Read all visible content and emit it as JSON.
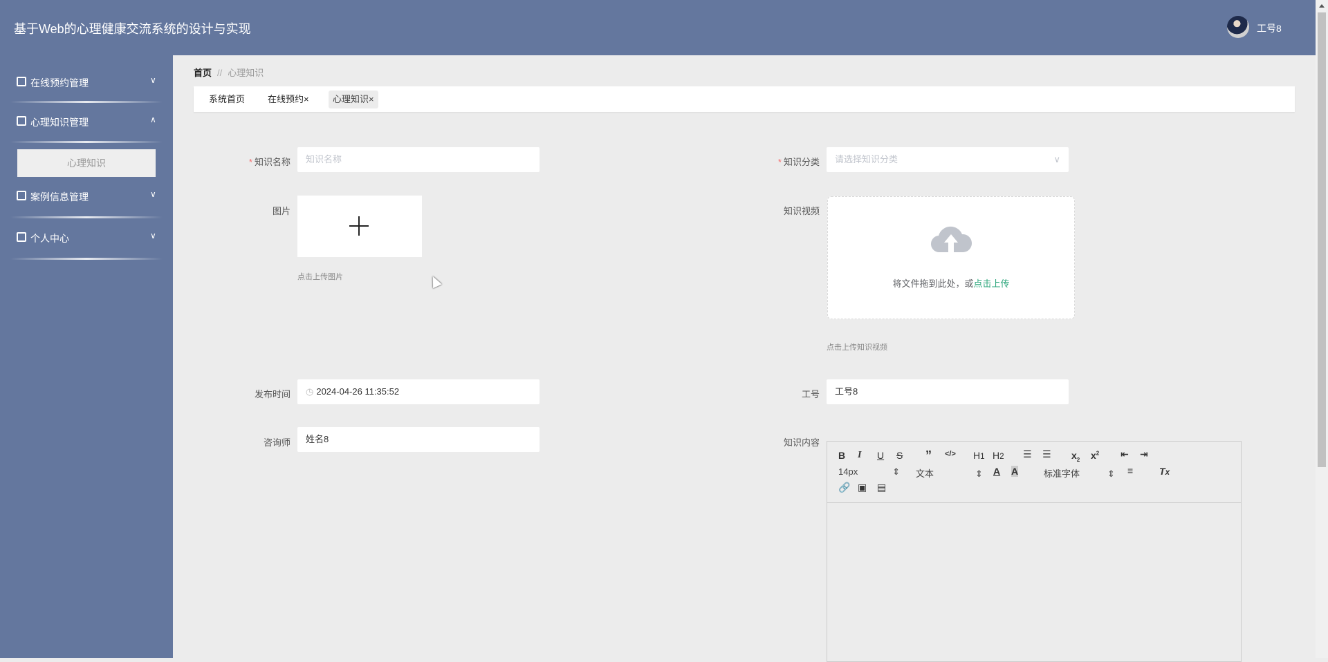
{
  "header": {
    "title": "基于Web的心理健康交流系统的设计与实现",
    "username": "工号8"
  },
  "sidebar": {
    "items": [
      {
        "label": "在线预约管理",
        "icon": "briefcase-icon",
        "expanded": false
      },
      {
        "label": "心理知识管理",
        "icon": "clipboard-icon",
        "expanded": true,
        "children": [
          "心理知识"
        ]
      },
      {
        "label": "案例信息管理",
        "icon": "grid-icon",
        "expanded": false
      },
      {
        "label": "个人中心",
        "icon": "wallet-icon",
        "expanded": false
      }
    ]
  },
  "breadcrumb": {
    "home": "首页",
    "separator": "//",
    "current": "心理知识"
  },
  "tabs": [
    {
      "label": "系统首页"
    },
    {
      "label": "在线预约",
      "close": "×"
    },
    {
      "label": "心理知识",
      "close": "×",
      "active": true
    }
  ],
  "form": {
    "name": {
      "label": "知识名称",
      "placeholder": "知识名称",
      "value": ""
    },
    "category": {
      "label": "知识分类",
      "placeholder": "请选择知识分类"
    },
    "picture": {
      "label": "图片",
      "hint": "点击上传图片"
    },
    "video": {
      "label": "知识视频",
      "drop_text": "将文件拖到此处，或",
      "click_text": "点击上传",
      "hint": "点击上传知识视频"
    },
    "publish_time": {
      "label": "发布时间",
      "value": "2024-04-26 11:35:52"
    },
    "staff_no": {
      "label": "工号",
      "value": "工号8"
    },
    "counselor": {
      "label": "咨询师",
      "value": "姓名8"
    },
    "content": {
      "label": "知识内容",
      "font_size": "14px",
      "block_type": "文本",
      "font_family": "标准字体"
    }
  },
  "colors": {
    "header": "#64779e",
    "link_green": "#2aa57a",
    "required": "#f56c6c"
  }
}
